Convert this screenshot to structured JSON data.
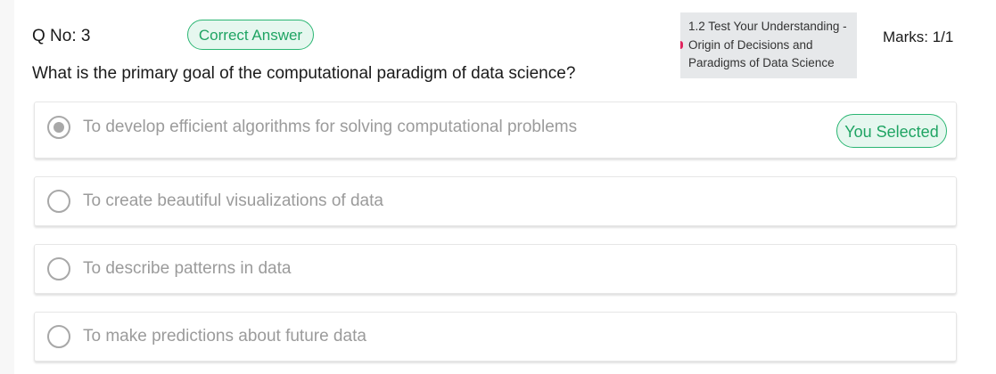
{
  "question": {
    "number_label": "Q No: 3",
    "status_badge": "Correct Answer",
    "text": "What is the primary goal of the computational paradigm of data science?",
    "marks": "Marks: 1/1"
  },
  "topic": {
    "lines": [
      "1.2 Test Your Understanding -",
      "Origin of Decisions and",
      "Paradigms of Data Science"
    ]
  },
  "options": [
    {
      "label": "To develop efficient algorithms for solving computational problems",
      "selected": true,
      "badge": "You Selected"
    },
    {
      "label": "To create beautiful visualizations of data",
      "selected": false
    },
    {
      "label": "To describe patterns in data",
      "selected": false
    },
    {
      "label": "To make predictions about future data",
      "selected": false
    }
  ],
  "colors": {
    "accent_green": "#2bb673",
    "badge_bg": "#e6f7ef",
    "muted_text": "#9b9b9b",
    "topic_bg": "#e6e8ea"
  }
}
